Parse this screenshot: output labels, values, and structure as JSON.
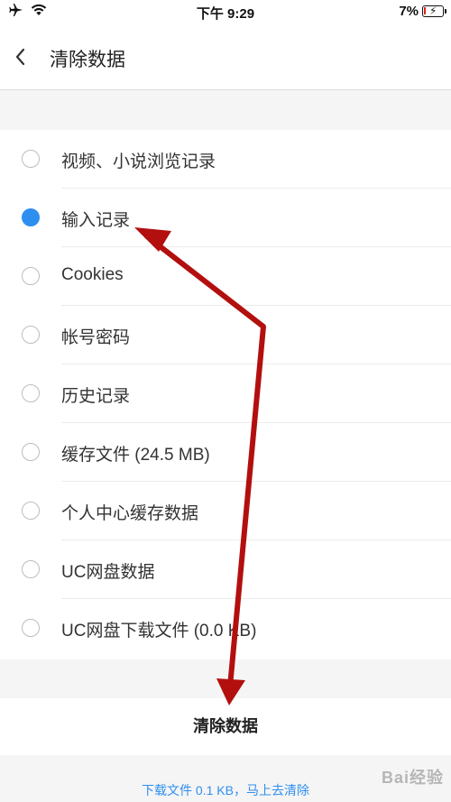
{
  "status_bar": {
    "time": "下午 9:29",
    "battery_percent": "7%",
    "icons": [
      "airplane-icon",
      "wifi-icon",
      "battery-charging-icon"
    ]
  },
  "nav": {
    "title": "清除数据",
    "back_icon": "chevron-left-icon"
  },
  "options": [
    {
      "label": "视频、小说浏览记录",
      "checked": false
    },
    {
      "label": "输入记录",
      "checked": true
    },
    {
      "label": "Cookies",
      "checked": false
    },
    {
      "label": "帐号密码",
      "checked": false
    },
    {
      "label": "历史记录",
      "checked": false
    },
    {
      "label": "缓存文件 (24.5 MB)",
      "checked": false
    },
    {
      "label": "个人中心缓存数据",
      "checked": false
    },
    {
      "label": "UC网盘数据",
      "checked": false
    },
    {
      "label": "UC网盘下载文件 (0.0 KB)",
      "checked": false
    }
  ],
  "clear_button": {
    "label": "清除数据"
  },
  "footer": {
    "link_text": "下载文件 0.1 KB，马上去清除"
  },
  "watermark": {
    "text": "Bai经验"
  },
  "colors": {
    "accent": "#2e8ff0",
    "annotation_arrow": "#b30f0f",
    "battery_low": "#e02020"
  },
  "battery_level": 0.07
}
